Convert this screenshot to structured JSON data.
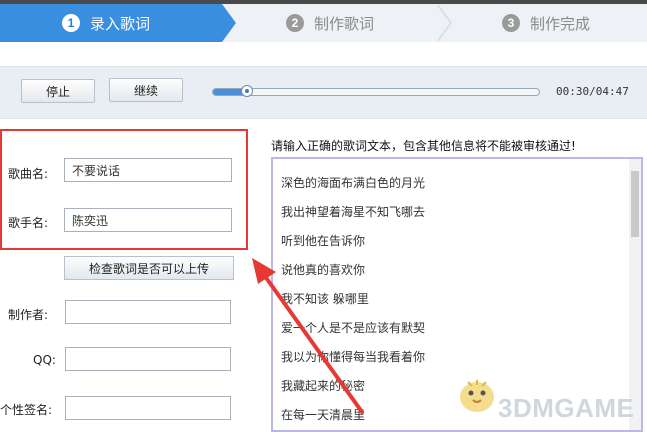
{
  "steps": [
    {
      "num": "1",
      "label": "录入歌词"
    },
    {
      "num": "2",
      "label": "制作歌词"
    },
    {
      "num": "3",
      "label": "制作完成"
    }
  ],
  "player": {
    "stop_label": "停止",
    "continue_label": "继续",
    "progress": 0.106,
    "time_display": "00:30/04:47"
  },
  "form": {
    "song_name_label": "歌曲名:",
    "song_name_value": "不要说话",
    "singer_label": "歌手名:",
    "singer_value": "陈奕迅",
    "check_button": "检查歌词是否可以上传",
    "producer_label": "制作者:",
    "qq_label": "QQ:",
    "signature_label": "个性签名:"
  },
  "lyrics": {
    "hint": "请输入正确的歌词文本，包含其他信息将不能被审核通过!",
    "lines": [
      "深色的海面布满白色的月光",
      "我出神望着海星不知飞哪去",
      "听到他在告诉你",
      "说他真的喜欢你",
      "我不知该 躲哪里",
      "爱一个人是不是应该有默契",
      "我以为你懂得每当我看着你",
      "我藏起来的秘密",
      "在每一天清晨里"
    ]
  },
  "colors": {
    "active_step": "#3a8ee0",
    "highlight_box": "#e53935",
    "arrow": "#e53935"
  },
  "watermark": "3DMGAME"
}
